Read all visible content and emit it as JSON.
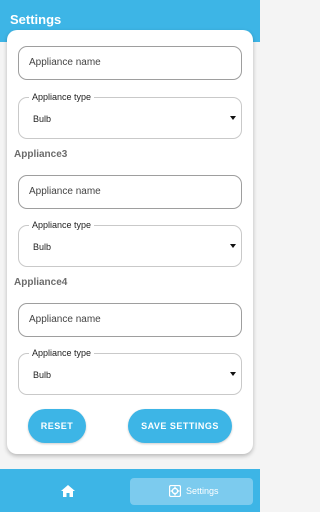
{
  "app": {
    "title": "Settings"
  },
  "form": {
    "appliance_top": {
      "name_placeholder": "Appliance name",
      "type_label": "Appliance type",
      "type_value": "Bulb"
    },
    "appliance3": {
      "heading": "Appliance3",
      "name_placeholder": "Appliance name",
      "type_label": "Appliance type",
      "type_value": "Bulb"
    },
    "appliance4": {
      "heading": "Appliance4",
      "name_placeholder": "Appliance name",
      "type_label": "Appliance type",
      "type_value": "Bulb"
    },
    "reset_label": "RESET",
    "save_label": "SAVE SETTINGS"
  },
  "nav": {
    "home_icon": "home-icon",
    "settings_icon": "gear-icon",
    "settings_label": "Settings"
  },
  "colors": {
    "primary": "#3db5e6",
    "nav_selected": "#7ccbee"
  }
}
